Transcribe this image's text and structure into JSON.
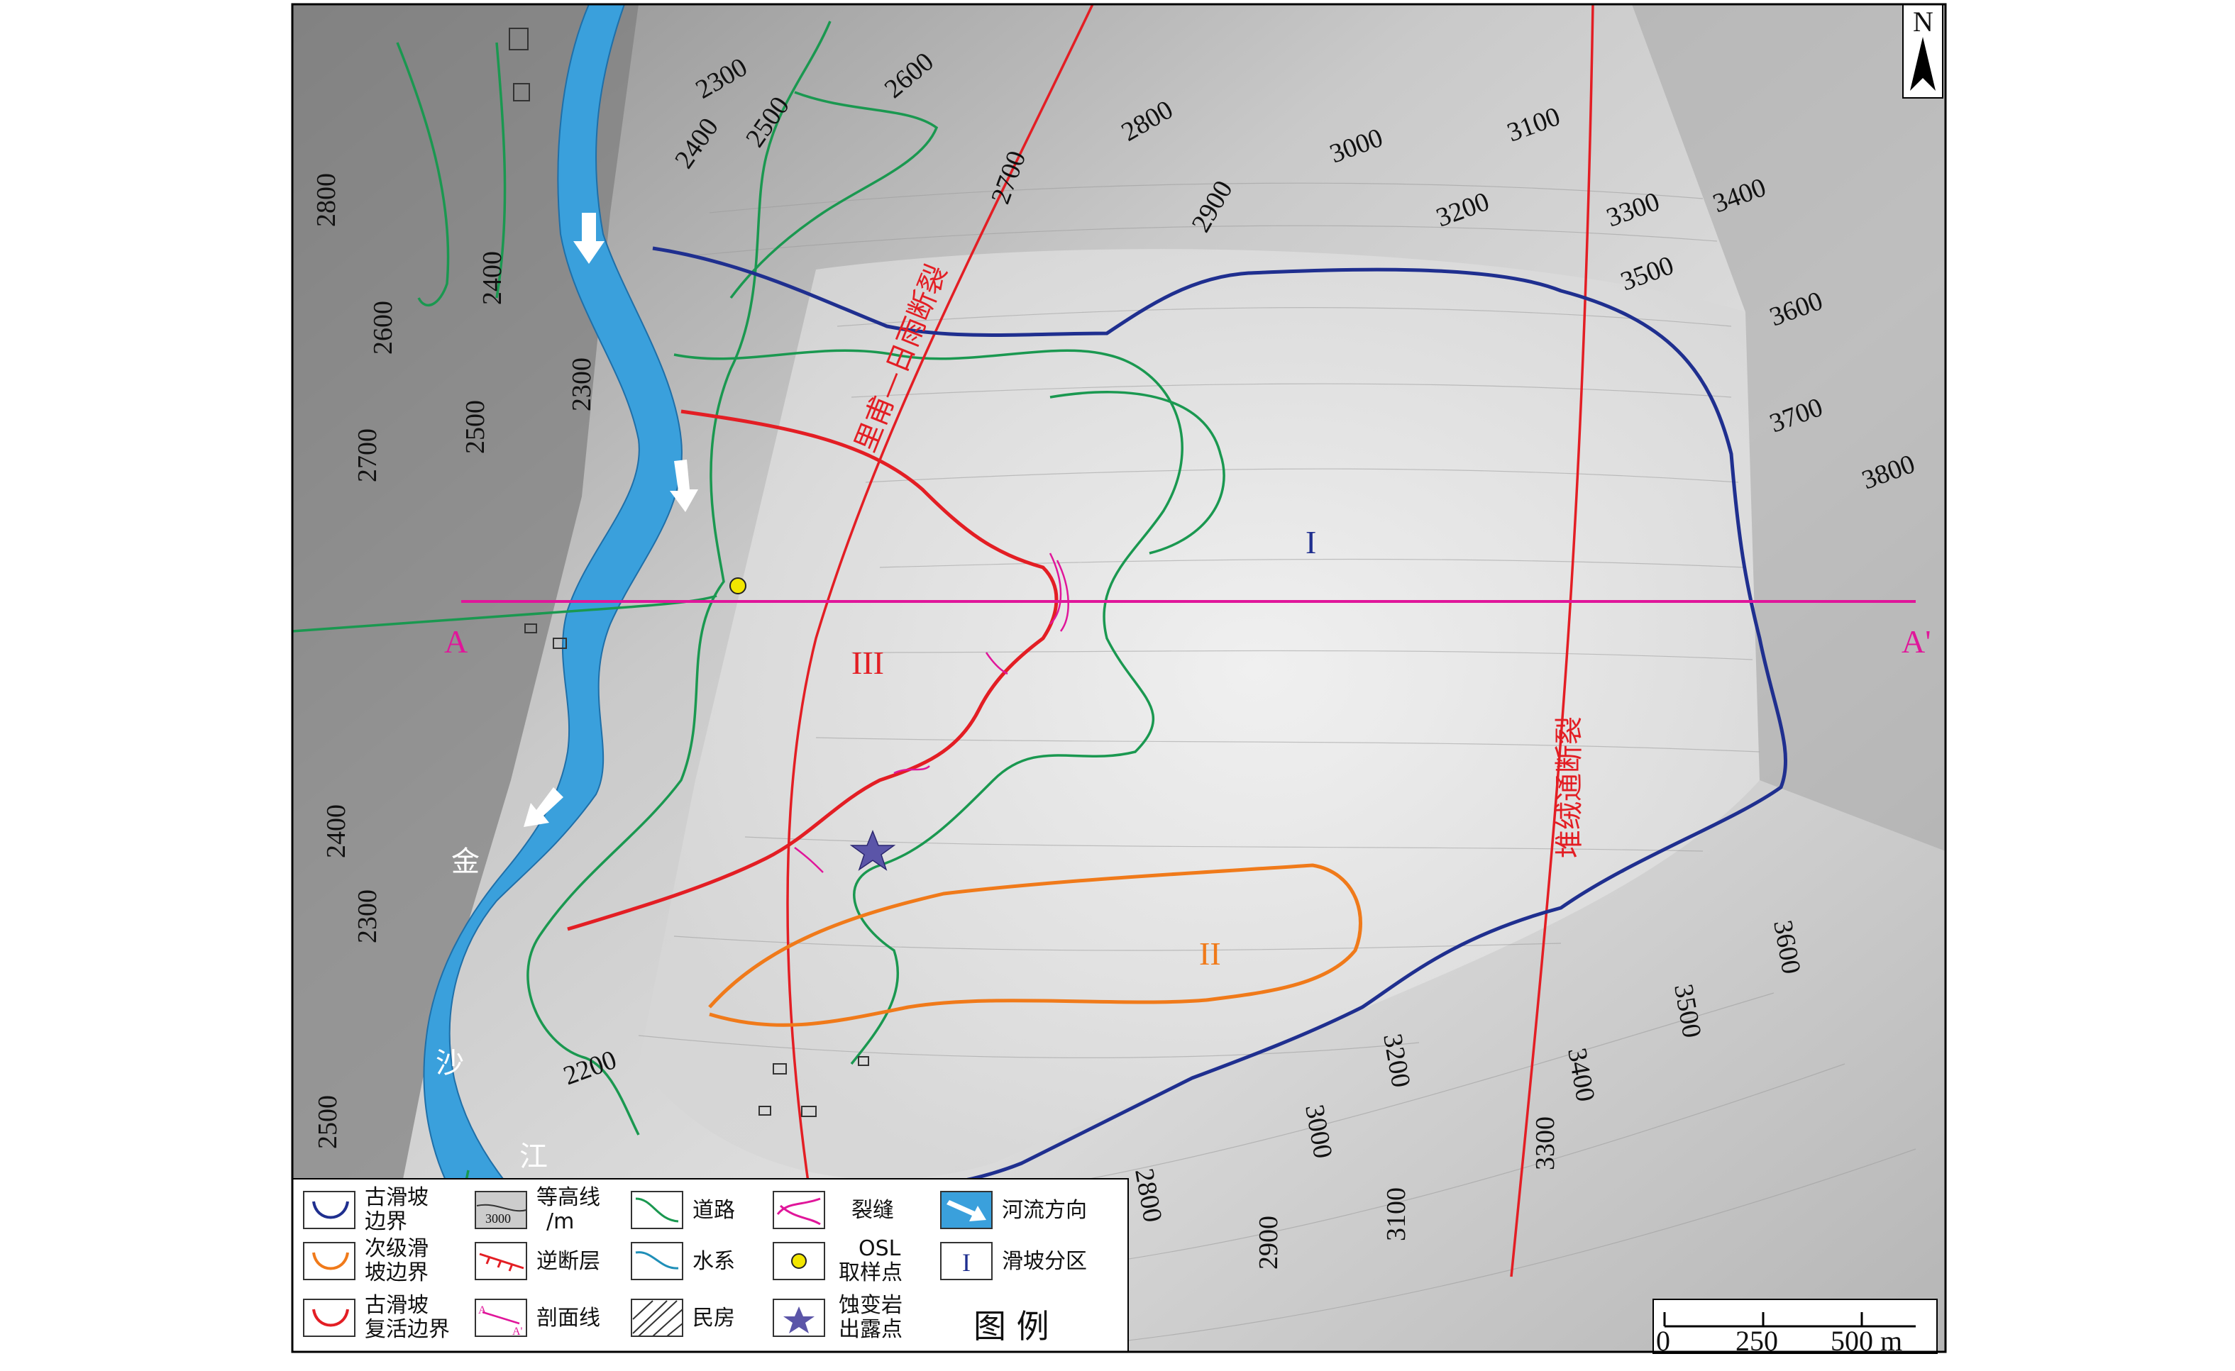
{
  "north_arrow": {
    "label": "N"
  },
  "contour_labels": [
    "2300",
    "2400",
    "2500",
    "2600",
    "2800",
    "2700",
    "2900",
    "3000",
    "3100",
    "3200",
    "3300",
    "3400",
    "3500",
    "3600",
    "3700",
    "3800",
    "2800",
    "2400",
    "2600",
    "2300",
    "2700",
    "2500",
    "2400",
    "2300",
    "2500",
    "2200",
    "2800",
    "3000",
    "3200",
    "3400",
    "3500",
    "3600",
    "2900",
    "3100",
    "3300"
  ],
  "faults": {
    "upper": "里甫—日雨断裂",
    "lower": "堆绒通断裂"
  },
  "section_line": {
    "start": "A",
    "end": "A'"
  },
  "zones": {
    "main": "I",
    "secondary": "II",
    "reactivated": "III"
  },
  "river": {
    "chars": [
      "金",
      "沙",
      "江"
    ]
  },
  "legend": {
    "title": "图  例",
    "items": [
      {
        "icon": "ancient-landslide-boundary-icon",
        "line1": "古滑坡",
        "line2": "边界"
      },
      {
        "icon": "contour-line-icon",
        "line1": "等高线",
        "line2": "/m",
        "sample": "3000"
      },
      {
        "icon": "road-icon",
        "line1": "道路",
        "line2": ""
      },
      {
        "icon": "crack-icon",
        "line1": "裂缝",
        "line2": ""
      },
      {
        "icon": "river-flow-direction-icon",
        "line1": "河流方向",
        "line2": ""
      },
      {
        "icon": "secondary-landslide-boundary-icon",
        "line1": "次级滑",
        "line2": "坡边界"
      },
      {
        "icon": "thrust-fault-icon",
        "line1": "逆断层",
        "line2": ""
      },
      {
        "icon": "water-system-icon",
        "line1": "水系",
        "line2": ""
      },
      {
        "icon": "osl-sample-point-icon",
        "line1": "OSL",
        "line2": "取样点"
      },
      {
        "icon": "landslide-zone-icon",
        "line1": "滑坡分区",
        "line2": "",
        "sample": "I"
      },
      {
        "icon": "reactivated-landslide-boundary-icon",
        "line1": "古滑坡",
        "line2": "复活边界"
      },
      {
        "icon": "section-line-icon",
        "line1": "剖面线",
        "line2": "",
        "sample_a": "A",
        "sample_b": "A'"
      },
      {
        "icon": "residential-house-icon",
        "line1": "民房",
        "line2": ""
      },
      {
        "icon": "altered-rock-outcrop-icon",
        "line1": "蚀变岩",
        "line2": "出露点"
      }
    ]
  },
  "scale_bar": {
    "labels": [
      "0",
      "250",
      "500 m"
    ]
  },
  "colors": {
    "ancient_boundary": "#1f2f8f",
    "secondary_boundary": "#f07a1a",
    "reactivated_boundary": "#e31e24",
    "fault": "#e31e24",
    "road": "#1a9850",
    "river": "#3aa0dc",
    "section_line": "#e0169a",
    "osl_point": "#f2e600",
    "outcrop_star": "#5b55a8"
  }
}
